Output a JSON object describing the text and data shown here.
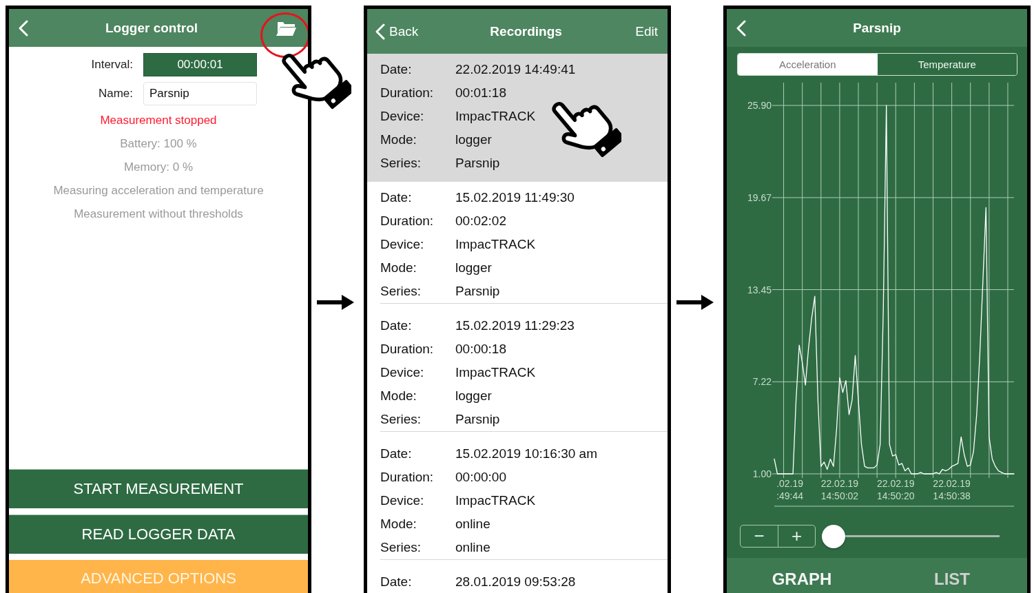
{
  "logger_control": {
    "title": "Logger control",
    "fields": [
      {
        "label": "Interval:",
        "value": "00:00:01",
        "kind": "picker"
      },
      {
        "label": "Name:",
        "value": "Parsnip",
        "kind": "text"
      }
    ],
    "status": "Measurement stopped",
    "info": [
      "Battery: 100 %",
      "Memory: 0 %",
      "Measuring acceleration and temperature",
      "Measurement without thresholds"
    ],
    "buttons": [
      {
        "label": "START MEASUREMENT",
        "kind": "primary"
      },
      {
        "label": "READ LOGGER DATA",
        "kind": "primary"
      },
      {
        "label": "ADVANCED OPTIONS",
        "kind": "warning"
      }
    ]
  },
  "recordings": {
    "back": "Back",
    "title": "Recordings",
    "edit": "Edit",
    "items": [
      {
        "selected": true,
        "rows": [
          {
            "label": "Date:",
            "value": "22.02.2019 14:49:41"
          },
          {
            "label": "Duration:",
            "value": "00:01:18"
          },
          {
            "label": "Device:",
            "value": "ImpacTRACK"
          },
          {
            "label": "Mode:",
            "value": "logger"
          },
          {
            "label": "Series:",
            "value": "Parsnip"
          }
        ]
      },
      {
        "selected": false,
        "rows": [
          {
            "label": "Date:",
            "value": "15.02.2019 11:49:30"
          },
          {
            "label": "Duration:",
            "value": "00:02:02"
          },
          {
            "label": "Device:",
            "value": "ImpacTRACK"
          },
          {
            "label": "Mode:",
            "value": "logger"
          },
          {
            "label": "Series:",
            "value": "Parsnip"
          }
        ]
      },
      {
        "selected": false,
        "rows": [
          {
            "label": "Date:",
            "value": "15.02.2019 11:29:23"
          },
          {
            "label": "Duration:",
            "value": "00:00:18"
          },
          {
            "label": "Device:",
            "value": "ImpacTRACK"
          },
          {
            "label": "Mode:",
            "value": "logger"
          },
          {
            "label": "Series:",
            "value": "Parsnip"
          }
        ]
      },
      {
        "selected": false,
        "rows": [
          {
            "label": "Date:",
            "value": "15.02.2019 10:16:30 am"
          },
          {
            "label": "Duration:",
            "value": "00:00:00"
          },
          {
            "label": "Device:",
            "value": "ImpacTRACK"
          },
          {
            "label": "Mode:",
            "value": "online"
          },
          {
            "label": "Series:",
            "value": "online"
          }
        ]
      },
      {
        "selected": false,
        "rows": [
          {
            "label": "Date:",
            "value": "28.01.2019 09:53:28"
          }
        ]
      }
    ]
  },
  "graph": {
    "title": "Parsnip",
    "segments": [
      {
        "label": "Acceleration",
        "selected": true
      },
      {
        "label": "Temperature",
        "selected": false
      }
    ],
    "chart_data": {
      "type": "line",
      "grid": true,
      "ylim": [
        -1.19,
        27.44
      ],
      "categories": [
        null,
        null,
        null,
        null,
        null,
        ".02.19 :49:44",
        null,
        null,
        null,
        null,
        null,
        null,
        null,
        null,
        null,
        null,
        null,
        null,
        null,
        null,
        null,
        "22.02.19 14:50:02",
        null,
        null,
        null,
        null,
        null,
        null,
        null,
        null,
        null,
        null,
        null,
        null,
        null,
        null,
        null,
        null,
        null,
        "22.02.19 14:50:20",
        null,
        null,
        null,
        null,
        null,
        null,
        null,
        null,
        null,
        null,
        null,
        null,
        null,
        null,
        null,
        null,
        null,
        "22.02.19 14:50:38",
        null,
        null,
        null,
        null,
        null,
        null,
        null,
        null,
        null,
        null,
        null,
        null,
        null,
        null,
        null,
        null,
        null,
        null,
        null,
        null
      ],
      "values": [
        2.0,
        1.0,
        1.0,
        1.0,
        1.0,
        1.0,
        1.0,
        6.0,
        9.7,
        8.5,
        7.0,
        9.5,
        11.5,
        13.0,
        6.0,
        1.5,
        1.8,
        1.3,
        2.0,
        1.5,
        4.0,
        7.5,
        6.5,
        7.3,
        5.0,
        6.0,
        9.0,
        6.0,
        3.0,
        1.5,
        1.4,
        1.4,
        1.4,
        1.6,
        3.0,
        12.0,
        25.9,
        3.0,
        2.2,
        2.3,
        1.6,
        1.7,
        1.2,
        1.4,
        1.0,
        1.0,
        1.0,
        1.1,
        1.0,
        1.0,
        1.0,
        1.0,
        1.1,
        1.0,
        1.3,
        1.2,
        1.3,
        1.5,
        1.6,
        1.7,
        3.5,
        2.3,
        1.5,
        1.6,
        2.5,
        5.0,
        9.0,
        14.0,
        19.0,
        3.5,
        2.0,
        1.5,
        1.2,
        1.1,
        1.0,
        1.0,
        1.0,
        1.0
      ],
      "yticks": [
        {
          "value": 1,
          "label": "1.00"
        },
        {
          "value": 7.22,
          "label": "7.22"
        },
        {
          "value": 13.45,
          "label": "13.45"
        },
        {
          "value": 19.67,
          "label": "19.67"
        },
        {
          "value": 25.9,
          "label": "25.90"
        }
      ]
    },
    "zoom_out": "−",
    "zoom_in": "+",
    "zoom_slider": {
      "level": 0
    },
    "tabs": [
      {
        "label": "GRAPH",
        "selected": true
      },
      {
        "label": "LIST",
        "selected": false
      }
    ]
  }
}
